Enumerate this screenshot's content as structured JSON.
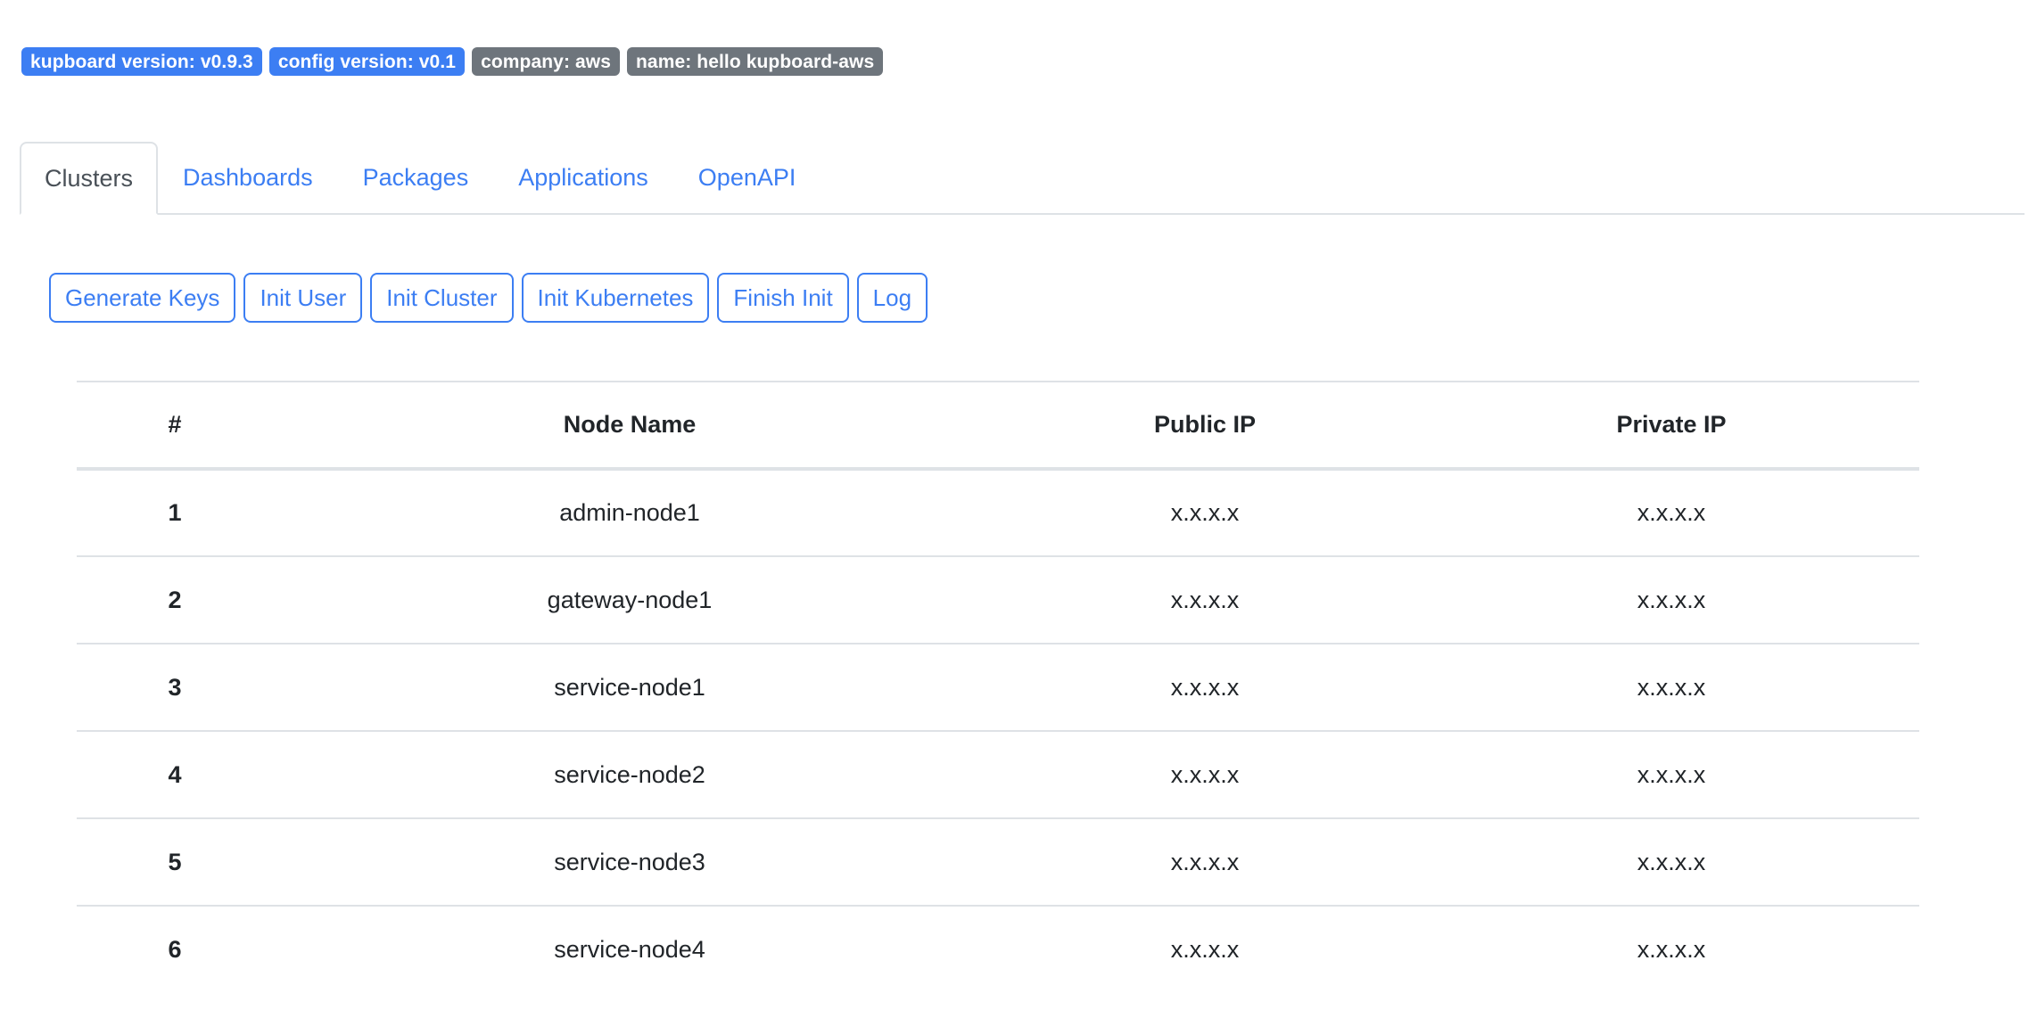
{
  "badges": [
    {
      "label": "kupboard version: v0.9.3",
      "style": "primary"
    },
    {
      "label": "config version: v0.1",
      "style": "primary"
    },
    {
      "label": "company: aws",
      "style": "secondary"
    },
    {
      "label": "name: hello kupboard-aws",
      "style": "secondary"
    }
  ],
  "tabs": [
    {
      "label": "Clusters",
      "active": true
    },
    {
      "label": "Dashboards",
      "active": false
    },
    {
      "label": "Packages",
      "active": false
    },
    {
      "label": "Applications",
      "active": false
    },
    {
      "label": "OpenAPI",
      "active": false
    }
  ],
  "actions": [
    {
      "label": "Generate Keys"
    },
    {
      "label": "Init User"
    },
    {
      "label": "Init Cluster"
    },
    {
      "label": "Init Kubernetes"
    },
    {
      "label": "Finish Init"
    },
    {
      "label": "Log"
    }
  ],
  "table": {
    "columns": [
      "#",
      "Node Name",
      "Public IP",
      "Private IP"
    ],
    "rows": [
      {
        "index": "1",
        "name": "admin-node1",
        "public_ip": "x.x.x.x",
        "private_ip": "x.x.x.x"
      },
      {
        "index": "2",
        "name": "gateway-node1",
        "public_ip": "x.x.x.x",
        "private_ip": "x.x.x.x"
      },
      {
        "index": "3",
        "name": "service-node1",
        "public_ip": "x.x.x.x",
        "private_ip": "x.x.x.x"
      },
      {
        "index": "4",
        "name": "service-node2",
        "public_ip": "x.x.x.x",
        "private_ip": "x.x.x.x"
      },
      {
        "index": "5",
        "name": "service-node3",
        "public_ip": "x.x.x.x",
        "private_ip": "x.x.x.x"
      },
      {
        "index": "6",
        "name": "service-node4",
        "public_ip": "x.x.x.x",
        "private_ip": "x.x.x.x"
      }
    ]
  },
  "colors": {
    "primary": "#3c7ef3",
    "secondary": "#6e757c",
    "border": "#dee2e6",
    "text": "#212529",
    "muted_tab": "#495057"
  }
}
